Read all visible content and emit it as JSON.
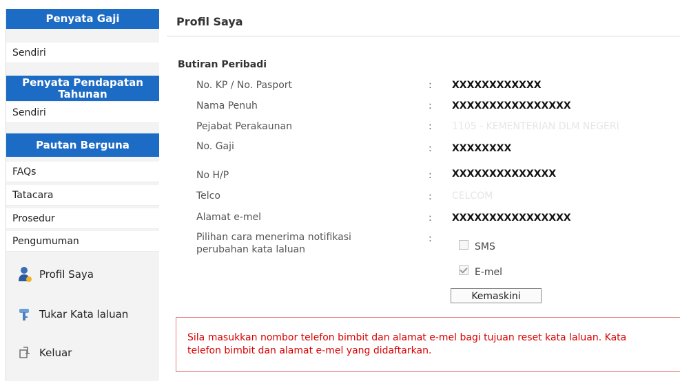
{
  "sidebar": {
    "section1": {
      "title": "Penyata Gaji",
      "items": [
        "Sendiri"
      ]
    },
    "section2": {
      "title_line1": "Penyata Pendapatan",
      "title_line2": "Tahunan",
      "items": [
        "Sendiri"
      ]
    },
    "section3": {
      "title": "Pautan Berguna",
      "items": [
        "FAQs",
        "Tatacara",
        "Prosedur",
        "Pengumuman"
      ]
    },
    "menu": [
      {
        "label": "Profil Saya",
        "icon": "user-profile-icon"
      },
      {
        "label": "Tukar Kata laluan",
        "icon": "key-icon"
      },
      {
        "label": "Keluar",
        "icon": "logout-icon"
      }
    ]
  },
  "main": {
    "title": "Profil Saya",
    "section_title": "Butiran Peribadi",
    "fields": [
      {
        "label": "No. KP / No. Pasport",
        "value": "XXXXXXXXXXXX"
      },
      {
        "label": "Nama Penuh",
        "value": "XXXXXXXXXXXXXXXX"
      },
      {
        "label": "Pejabat Perakaunan",
        "value": "1105 - KEMENTERIAN DLM NEGERI"
      },
      {
        "label": "No. Gaji",
        "value": "XXXXXXXX"
      },
      {
        "label": "No H/P",
        "value": "XXXXXXXXXXXXXX"
      },
      {
        "label": "Telco",
        "value": "CELCOM"
      },
      {
        "label": "Alamat e-mel",
        "value": "XXXXXXXXXXXXXXXX"
      }
    ],
    "notification": {
      "label_line1": "Pilihan cara menerima notifikasi",
      "label_line2": "perubahan kata laluan",
      "options": [
        {
          "label": "SMS",
          "checked": false
        },
        {
          "label": "E-mel",
          "checked": true
        }
      ]
    },
    "colon": ":",
    "update_button": "Kemaskini",
    "notice_line1": "Sila masukkan nombor telefon bimbit dan alamat e-mel bagi tujuan reset kata laluan. Kata",
    "notice_line2": "telefon bimbit dan alamat e-mel yang didaftarkan."
  },
  "colors": {
    "sidebar_header": "#1c6bc4",
    "notice_border": "#e58080",
    "notice_text": "#d80000"
  }
}
